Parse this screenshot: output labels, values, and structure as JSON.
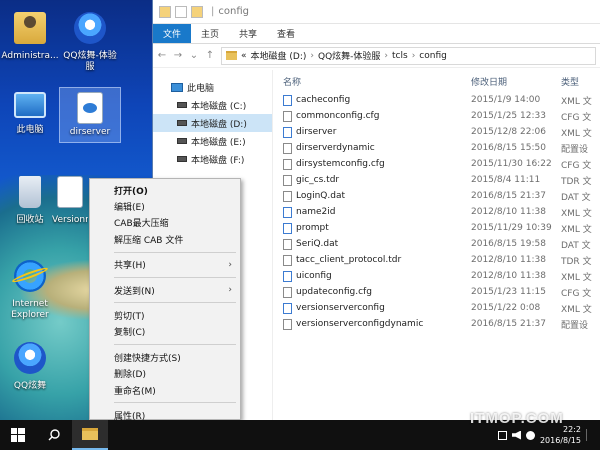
{
  "desktop": {
    "icons": [
      {
        "label": "Administra..."
      },
      {
        "label": "QQ炫舞-体验服"
      },
      {
        "label": "此电脑"
      },
      {
        "label": "dirserver"
      },
      {
        "label": "回收站"
      },
      {
        "label": "VersionrCo"
      },
      {
        "label": "Internet Explorer"
      },
      {
        "label": "QQ炫舞"
      }
    ]
  },
  "explorer": {
    "title": "config",
    "ribbon_tabs": [
      "文件",
      "主页",
      "共享",
      "查看"
    ],
    "address": [
      "«",
      "本地磁盘 (D:)",
      "QQ炫舞-体验服",
      "tcls",
      "config"
    ],
    "nav": [
      {
        "label": "此电脑"
      },
      {
        "label": "本地磁盘 (C:)"
      },
      {
        "label": "本地磁盘 (D:)"
      },
      {
        "label": "本地磁盘 (E:)"
      },
      {
        "label": "本地磁盘 (F:)"
      }
    ],
    "columns": {
      "name": "名称",
      "date": "修改日期",
      "type": "类型"
    },
    "files": [
      {
        "name": "cacheconfig",
        "date": "2015/1/9 14:00",
        "type": "XML 文",
        "kind": "xml"
      },
      {
        "name": "commonconfig.cfg",
        "date": "2015/1/25 12:33",
        "type": "CFG 文",
        "kind": "file"
      },
      {
        "name": "dirserver",
        "date": "2015/12/8 22:06",
        "type": "XML 文",
        "kind": "xml"
      },
      {
        "name": "dirserverdynamic",
        "date": "2016/8/15 15:50",
        "type": "配置设",
        "kind": "file"
      },
      {
        "name": "dirsystemconfig.cfg",
        "date": "2015/11/30 16:22",
        "type": "CFG 文",
        "kind": "file"
      },
      {
        "name": "gic_cs.tdr",
        "date": "2015/8/4 11:11",
        "type": "TDR 文",
        "kind": "file"
      },
      {
        "name": "LoginQ.dat",
        "date": "2016/8/15 21:37",
        "type": "DAT 文",
        "kind": "file"
      },
      {
        "name": "name2id",
        "date": "2012/8/10 11:38",
        "type": "XML 文",
        "kind": "xml"
      },
      {
        "name": "prompt",
        "date": "2015/11/29 10:39",
        "type": "XML 文",
        "kind": "xml"
      },
      {
        "name": "SeriQ.dat",
        "date": "2016/8/15 19:58",
        "type": "DAT 文",
        "kind": "file"
      },
      {
        "name": "tacc_client_protocol.tdr",
        "date": "2012/8/10 11:38",
        "type": "TDR 文",
        "kind": "file"
      },
      {
        "name": "uiconfig",
        "date": "2012/8/10 11:38",
        "type": "XML 文",
        "kind": "xml"
      },
      {
        "name": "updateconfig.cfg",
        "date": "2015/1/23 11:15",
        "type": "CFG 文",
        "kind": "file"
      },
      {
        "name": "versionserverconfig",
        "date": "2015/1/22 0:08",
        "type": "XML 文",
        "kind": "xml"
      },
      {
        "name": "versionserverconfigdynamic",
        "date": "2016/8/15 21:37",
        "type": "配置设",
        "kind": "file"
      }
    ]
  },
  "context_menu": {
    "groups": [
      [
        {
          "label": "打开(O)",
          "bold": true
        },
        {
          "label": "编辑(E)"
        },
        {
          "label": "CAB最大压缩"
        },
        {
          "label": "解压缩 CAB 文件"
        }
      ],
      [
        {
          "label": "共享(H)",
          "submenu": true
        }
      ],
      [
        {
          "label": "发送到(N)",
          "submenu": true
        }
      ],
      [
        {
          "label": "剪切(T)"
        },
        {
          "label": "复制(C)"
        }
      ],
      [
        {
          "label": "创建快捷方式(S)"
        },
        {
          "label": "删除(D)"
        },
        {
          "label": "重命名(M)"
        }
      ],
      [
        {
          "label": "属性(R)"
        }
      ]
    ]
  },
  "taskbar": {
    "clock_time": "22:2",
    "clock_date": "2016/8/15"
  },
  "watermark": "ITMOP.COM",
  "colors": {
    "ribbon_file": "#1979ca",
    "selection": "#cce4f7"
  }
}
